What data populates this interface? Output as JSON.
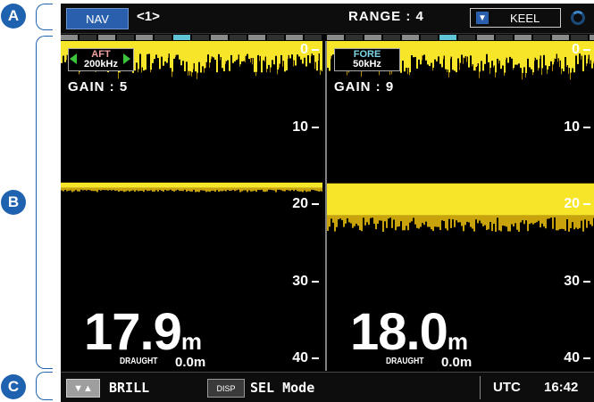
{
  "callouts": [
    "A",
    "B",
    "C"
  ],
  "header": {
    "mode": "NAV",
    "screen": "<1>",
    "range": "RANGE : 4",
    "reference": "KEEL"
  },
  "scale_depths": [
    "0",
    "10",
    "20",
    "30",
    "40"
  ],
  "left_panel": {
    "channel": "AFT",
    "frequency": "200kHz",
    "gain": "GAIN : 5",
    "depth": "17.9",
    "depth_unit": "m",
    "draught_label": "DRAUGHT",
    "draught_value": "0.0m",
    "bottom_depth_m": 17.9
  },
  "right_panel": {
    "channel": "FORE",
    "frequency": "50kHz",
    "gain": "GAIN : 9",
    "depth": "18.0",
    "depth_unit": "m",
    "draught_label": "DRAUGHT",
    "draught_value": "0.0m",
    "bottom_depth_m": 18.0
  },
  "footer": {
    "brill_label": "BRILL",
    "disp_label": "DISP",
    "sel_mode": "SEL Mode",
    "utc_label": "UTC",
    "time": "16:42"
  },
  "colors": {
    "echo_strong": "#f7e52a",
    "aft_label": "#f0a0a0",
    "fore_label": "#7fd4e6",
    "nav_badge": "#2a5fae",
    "callout": "#1f63b0"
  }
}
